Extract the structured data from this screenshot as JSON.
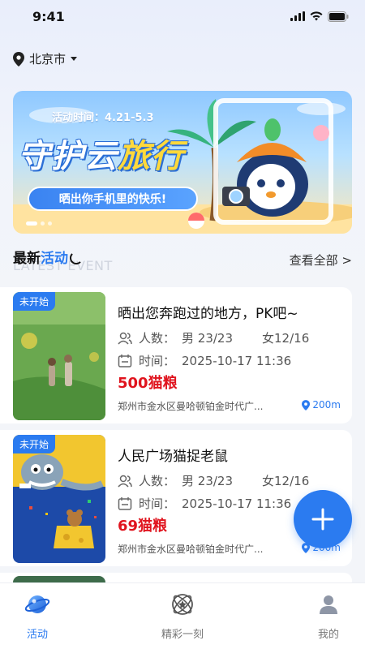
{
  "status": {
    "time": "9:41"
  },
  "location": {
    "city": "北京市"
  },
  "banner": {
    "date": "活动时间：4.21-5.3",
    "title_part1": "守护云",
    "title_highlight": "旅行",
    "slogan": "晒出你手机里的快乐!"
  },
  "section": {
    "title_black": "最新",
    "title_blue": "活动",
    "subtitle": "LATEST EVENT",
    "view_all": "查看全部 >"
  },
  "events": [
    {
      "tag": "未开始",
      "title": "晒出您奔跑过的地方，PK吧~",
      "people_label": "人数：",
      "male": "男  23/23",
      "female": "女12/16",
      "time_label": "时间：",
      "time": "2025-10-17  11:36",
      "price": "500猫粮",
      "address": "郑州市金水区曼哈顿铂金时代广...",
      "distance": "200m"
    },
    {
      "tag": "未开始",
      "title": "人民广场猫捉老鼠",
      "people_label": "人数：",
      "male": "男  23/23",
      "female": "女12/16",
      "time_label": "时间：",
      "time": "2025-10-17  11:36",
      "price": "69猫粮",
      "address": "郑州市金水区曼哈顿铂金时代广...",
      "distance": "200m"
    }
  ],
  "tabs": [
    {
      "label": "活动",
      "icon": "planet-icon",
      "active": true
    },
    {
      "label": "精彩一刻",
      "icon": "star-badge-icon",
      "active": false
    },
    {
      "label": "我的",
      "icon": "user-icon",
      "active": false
    }
  ],
  "colors": {
    "accent": "#2b7bf0",
    "price": "#e0141e"
  }
}
